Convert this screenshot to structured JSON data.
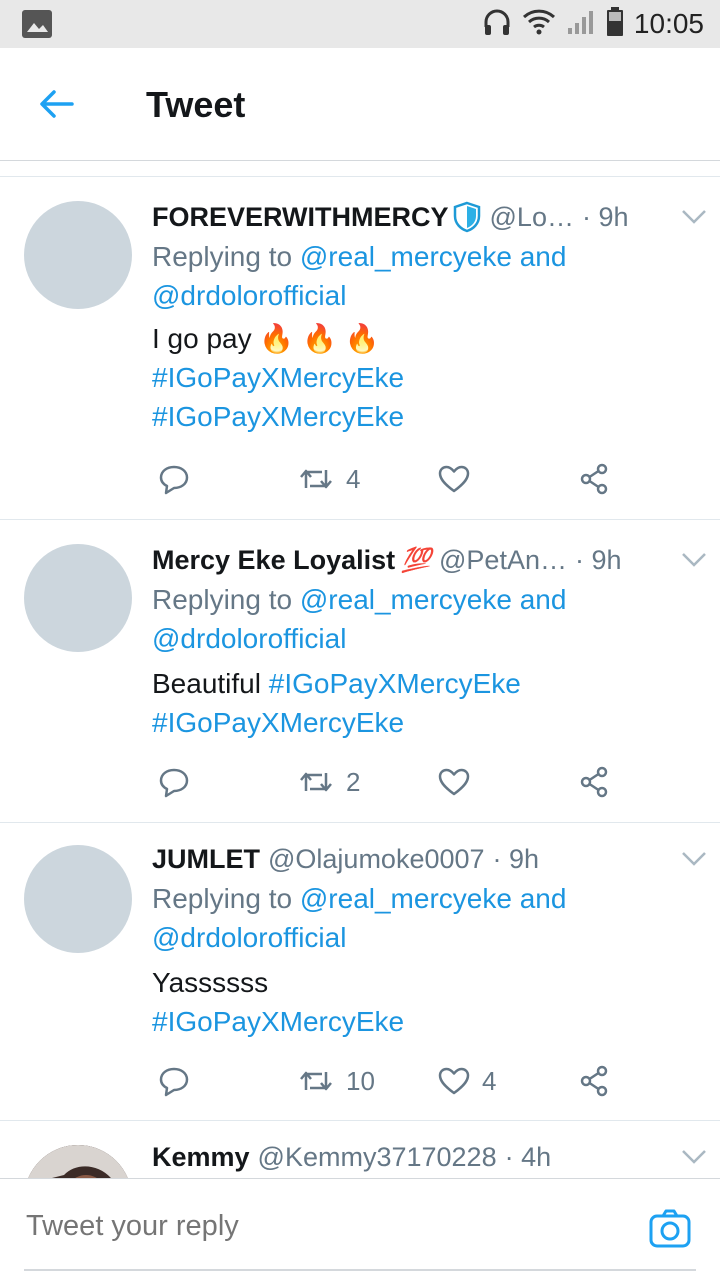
{
  "status_bar": {
    "time": "10:05"
  },
  "app_bar": {
    "title": "Tweet"
  },
  "tweets": [
    {
      "name": "FOREVERWITHMERCY",
      "verified_shield": true,
      "handle": "@Lo…",
      "time": "· 9h",
      "replying_prefix": "Replying to ",
      "replying_1": "@real_mercyeke",
      "replying_and": " and",
      "replying_2": "@drdolorofficial",
      "body_text": "I go pay ",
      "body_emoji": "🔥 🔥 🔥",
      "hashtag_1": "#IGoPayXMercyEke",
      "hashtag_2": "#IGoPayXMercyEke",
      "retweets": "4",
      "likes": ""
    },
    {
      "name": "Mercy Eke Loyalist",
      "name_emoji": "💯",
      "handle": "@PetAn…",
      "time": "· 9h",
      "replying_prefix": "Replying to ",
      "replying_1": "@real_mercyeke",
      "replying_and": " and",
      "replying_2": "@drdolorofficial",
      "body_text": "Beautiful ",
      "hashtag_1": "#IGoPayXMercyEke",
      "hashtag_2": "#IGoPayXMercyEke",
      "retweets": "2",
      "likes": ""
    },
    {
      "name": "JUMLET",
      "handle": "@Olajumoke0007",
      "time": "· 9h",
      "replying_prefix": "Replying to ",
      "replying_1": "@real_mercyeke",
      "replying_and": " and",
      "replying_2": "@drdolorofficial",
      "body_text": "Yassssss",
      "hashtag_1": "#IGoPayXMercyEke",
      "retweets": "10",
      "likes": "4"
    },
    {
      "name": "Kemmy",
      "handle": "@Kemmy37170228",
      "time": "· 4h"
    }
  ],
  "composer": {
    "placeholder": "Tweet your reply"
  },
  "colors": {
    "accent": "#1da1f2",
    "link": "#1b95e0",
    "muted": "#657786",
    "avatar_placeholder": "#ccd6dd"
  },
  "icons": [
    "image-icon",
    "headphones-icon",
    "wifi-icon",
    "signal-icon",
    "battery-icon",
    "back-arrow-icon",
    "chevron-down-icon",
    "reply-icon",
    "retweet-icon",
    "like-icon",
    "share-icon",
    "camera-icon",
    "shield-icon"
  ]
}
